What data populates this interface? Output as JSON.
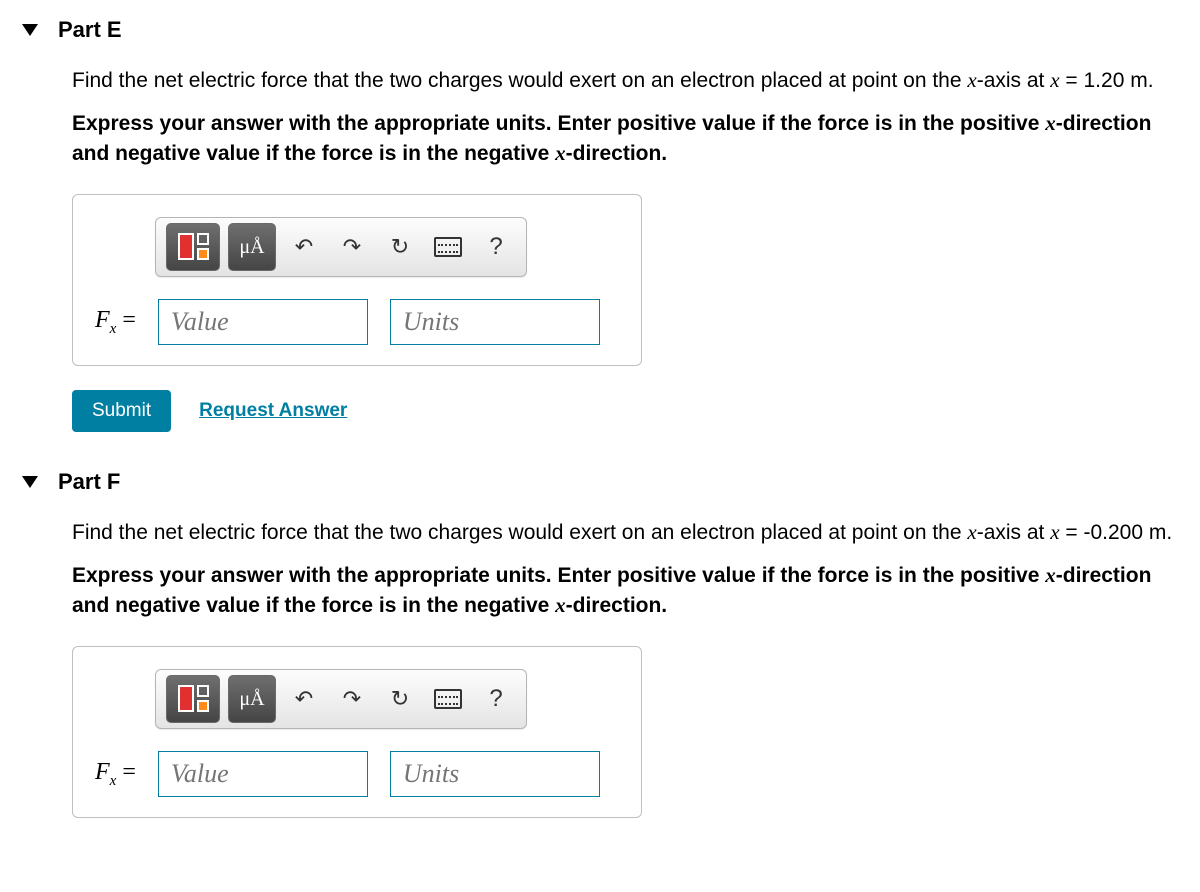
{
  "parts": [
    {
      "title": "Part E",
      "question_pre": "Find the net electric force that the two charges would exert on an electron placed at point on the ",
      "question_var": "x",
      "question_mid": "-axis at ",
      "question_eq_lhs": "x",
      "question_eq_rhs": " = 1.20 m.",
      "instruction": {
        "p1": "Express your answer with the appropriate units. Enter positive value if the force is in the positive ",
        "v1": "x",
        "p2": "-direction and negative value if the force is in the negative ",
        "v2": "x",
        "p3": "-direction."
      },
      "toolbar": {
        "units_btn": "μÅ",
        "help": "?"
      },
      "label": {
        "F": "F",
        "sub": "x",
        "eq": " ="
      },
      "value_placeholder": "Value",
      "units_placeholder": "Units",
      "submit": "Submit",
      "request": "Request Answer"
    },
    {
      "title": "Part F",
      "question_pre": "Find the net electric force that the two charges would exert on an electron placed at point on the ",
      "question_var": "x",
      "question_mid": "-axis at ",
      "question_eq_lhs": "x",
      "question_eq_rhs": " = -0.200 m.",
      "instruction": {
        "p1": "Express your answer with the appropriate units. Enter positive value if the force is in the positive ",
        "v1": "x",
        "p2": "-direction and negative value if the force is in the negative ",
        "v2": "x",
        "p3": "-direction."
      },
      "toolbar": {
        "units_btn": "μÅ",
        "help": "?"
      },
      "label": {
        "F": "F",
        "sub": "x",
        "eq": " ="
      },
      "value_placeholder": "Value",
      "units_placeholder": "Units"
    }
  ]
}
